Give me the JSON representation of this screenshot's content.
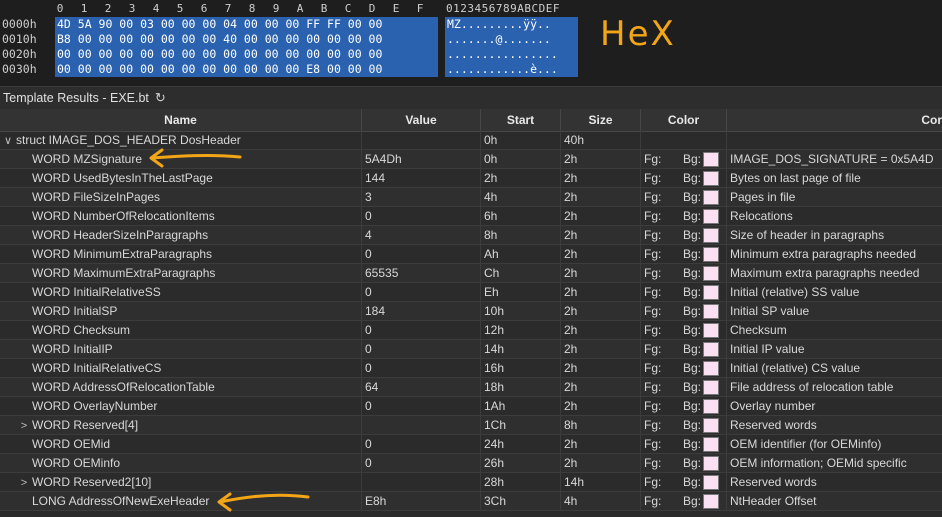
{
  "hex": {
    "column_numbers": [
      "0",
      "1",
      "2",
      "3",
      "4",
      "5",
      "6",
      "7",
      "8",
      "9",
      "A",
      "B",
      "C",
      "D",
      "E",
      "F"
    ],
    "ascii_header": "0123456789ABCDEF",
    "annotation": "HeX",
    "rows": [
      {
        "offset": "0000h",
        "bytes": "4D 5A 90 00 03 00 00 00 04 00 00 00 FF FF 00 00",
        "ascii": "MZ.........ÿÿ.."
      },
      {
        "offset": "0010h",
        "bytes": "B8 00 00 00 00 00 00 00 40 00 00 00 00 00 00 00",
        "ascii": ".......@......."
      },
      {
        "offset": "0020h",
        "bytes": "00 00 00 00 00 00 00 00 00 00 00 00 00 00 00 00",
        "ascii": "................"
      },
      {
        "offset": "0030h",
        "bytes": "00 00 00 00 00 00 00 00 00 00 00 00 E8 00 00 00",
        "ascii": "............è..."
      }
    ]
  },
  "template": {
    "title": "Template Results - EXE.bt",
    "columns": [
      "Name",
      "Value",
      "Start",
      "Size",
      "Color",
      "Cor"
    ],
    "rows": [
      {
        "name": "struct IMAGE_DOS_HEADER DosHeader",
        "value": "",
        "start": "0h",
        "size": "40h",
        "fg": "",
        "bg": "",
        "comment": "",
        "expander": "∨",
        "indent": 0
      },
      {
        "name": "WORD MZSignature",
        "value": "5A4Dh",
        "start": "0h",
        "size": "2h",
        "fg": "Fg:",
        "bg": "Bg:",
        "comment": "IMAGE_DOS_SIGNATURE = 0x5A4D",
        "expander": "",
        "indent": 1
      },
      {
        "name": "WORD UsedBytesInTheLastPage",
        "value": "144",
        "start": "2h",
        "size": "2h",
        "fg": "Fg:",
        "bg": "Bg:",
        "comment": "Bytes on last page of file",
        "expander": "",
        "indent": 1
      },
      {
        "name": "WORD FileSizeInPages",
        "value": "3",
        "start": "4h",
        "size": "2h",
        "fg": "Fg:",
        "bg": "Bg:",
        "comment": "Pages in file",
        "expander": "",
        "indent": 1
      },
      {
        "name": "WORD NumberOfRelocationItems",
        "value": "0",
        "start": "6h",
        "size": "2h",
        "fg": "Fg:",
        "bg": "Bg:",
        "comment": "Relocations",
        "expander": "",
        "indent": 1
      },
      {
        "name": "WORD HeaderSizeInParagraphs",
        "value": "4",
        "start": "8h",
        "size": "2h",
        "fg": "Fg:",
        "bg": "Bg:",
        "comment": "Size of header in paragraphs",
        "expander": "",
        "indent": 1
      },
      {
        "name": "WORD MinimumExtraParagraphs",
        "value": "0",
        "start": "Ah",
        "size": "2h",
        "fg": "Fg:",
        "bg": "Bg:",
        "comment": "Minimum extra paragraphs needed",
        "expander": "",
        "indent": 1
      },
      {
        "name": "WORD MaximumExtraParagraphs",
        "value": "65535",
        "start": "Ch",
        "size": "2h",
        "fg": "Fg:",
        "bg": "Bg:",
        "comment": "Maximum extra paragraphs needed",
        "expander": "",
        "indent": 1
      },
      {
        "name": "WORD InitialRelativeSS",
        "value": "0",
        "start": "Eh",
        "size": "2h",
        "fg": "Fg:",
        "bg": "Bg:",
        "comment": "Initial (relative) SS value",
        "expander": "",
        "indent": 1
      },
      {
        "name": "WORD InitialSP",
        "value": "184",
        "start": "10h",
        "size": "2h",
        "fg": "Fg:",
        "bg": "Bg:",
        "comment": "Initial SP value",
        "expander": "",
        "indent": 1
      },
      {
        "name": "WORD Checksum",
        "value": "0",
        "start": "12h",
        "size": "2h",
        "fg": "Fg:",
        "bg": "Bg:",
        "comment": "Checksum",
        "expander": "",
        "indent": 1
      },
      {
        "name": "WORD InitialIP",
        "value": "0",
        "start": "14h",
        "size": "2h",
        "fg": "Fg:",
        "bg": "Bg:",
        "comment": "Initial IP value",
        "expander": "",
        "indent": 1
      },
      {
        "name": "WORD InitialRelativeCS",
        "value": "0",
        "start": "16h",
        "size": "2h",
        "fg": "Fg:",
        "bg": "Bg:",
        "comment": "Initial (relative) CS value",
        "expander": "",
        "indent": 1
      },
      {
        "name": "WORD AddressOfRelocationTable",
        "value": "64",
        "start": "18h",
        "size": "2h",
        "fg": "Fg:",
        "bg": "Bg:",
        "comment": "File address of relocation table",
        "expander": "",
        "indent": 1
      },
      {
        "name": "WORD OverlayNumber",
        "value": "0",
        "start": "1Ah",
        "size": "2h",
        "fg": "Fg:",
        "bg": "Bg:",
        "comment": "Overlay number",
        "expander": "",
        "indent": 1
      },
      {
        "name": "WORD Reserved[4]",
        "value": "",
        "start": "1Ch",
        "size": "8h",
        "fg": "Fg:",
        "bg": "Bg:",
        "comment": "Reserved words",
        "expander": ">",
        "indent": 1
      },
      {
        "name": "WORD OEMid",
        "value": "0",
        "start": "24h",
        "size": "2h",
        "fg": "Fg:",
        "bg": "Bg:",
        "comment": "OEM identifier (for OEMinfo)",
        "expander": "",
        "indent": 1
      },
      {
        "name": "WORD OEMinfo",
        "value": "0",
        "start": "26h",
        "size": "2h",
        "fg": "Fg:",
        "bg": "Bg:",
        "comment": "OEM information; OEMid specific",
        "expander": "",
        "indent": 1
      },
      {
        "name": "WORD Reserved2[10]",
        "value": "",
        "start": "28h",
        "size": "14h",
        "fg": "Fg:",
        "bg": "Bg:",
        "comment": "Reserved words",
        "expander": ">",
        "indent": 1
      },
      {
        "name": "LONG AddressOfNewExeHeader",
        "value": "E8h",
        "start": "3Ch",
        "size": "4h",
        "fg": "Fg:",
        "bg": "Bg:",
        "comment": "NtHeader Offset",
        "expander": "",
        "indent": 1
      }
    ]
  },
  "colors": {
    "hex_selection": "#2a62b0",
    "annotation": "#f2a516",
    "bg_swatch": "#fbe0f4"
  }
}
